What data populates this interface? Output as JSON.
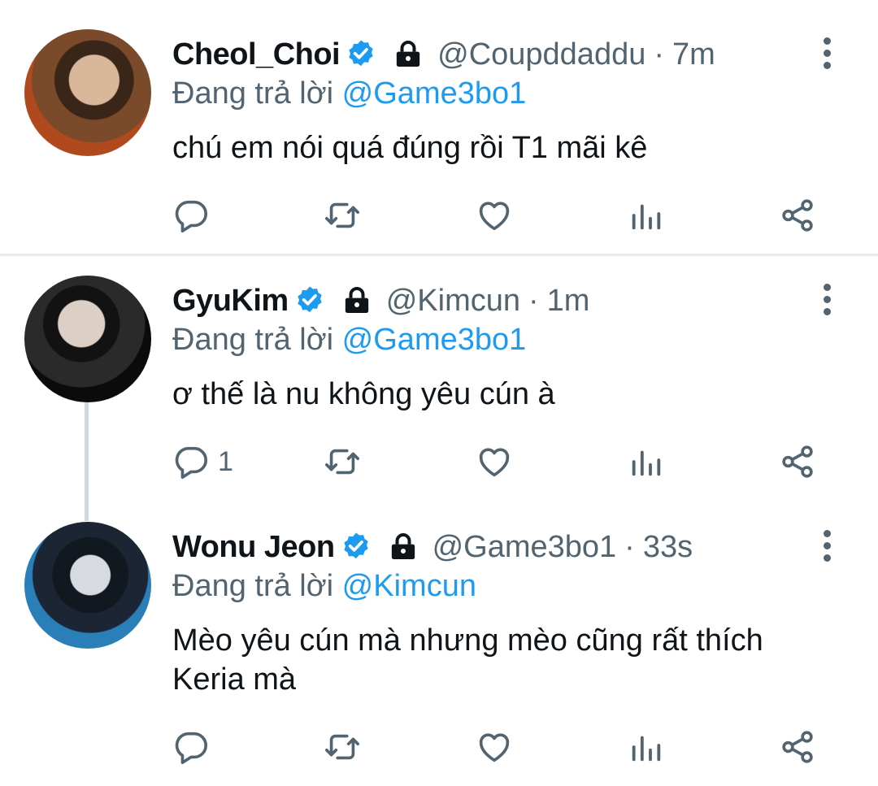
{
  "tweets": [
    {
      "name": "Cheol_Choi",
      "handle": "@Coupddaddu",
      "separator": "·",
      "time": "7m",
      "reply_prefix": "Đang trả lời",
      "reply_to": "@Game3bo1",
      "text": "chú em nói quá đúng rồi T1 mãi kê",
      "reply_count": ""
    },
    {
      "name": "GyuKim",
      "handle": "@Kimcun",
      "separator": "·",
      "time": "1m",
      "reply_prefix": "Đang trả lời",
      "reply_to": "@Game3bo1",
      "text": "ơ thế là nu không yêu cún à",
      "reply_count": "1"
    },
    {
      "name": "Wonu Jeon",
      "handle": "@Game3bo1",
      "separator": "·",
      "time": "33s",
      "reply_prefix": "Đang trả lời",
      "reply_to": "@Kimcun",
      "text": "Mèo yêu cún mà nhưng mèo cũng rất thích Keria mà",
      "reply_count": ""
    }
  ],
  "colors": {
    "accent": "#1d9bf0",
    "secondary_text": "#536471",
    "divider": "#e6ecf0"
  },
  "icons": [
    "verified-badge-icon",
    "lock-icon",
    "more-vertical-icon",
    "reply-icon",
    "retweet-icon",
    "like-icon",
    "analytics-icon",
    "share-icon"
  ]
}
